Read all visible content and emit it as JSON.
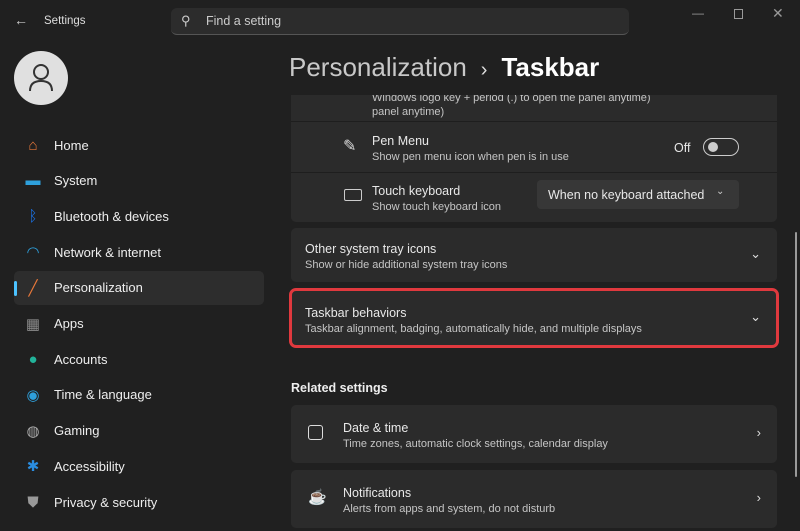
{
  "titlebar": {
    "title": "Settings",
    "search_placeholder": "Find a setting"
  },
  "breadcrumb": {
    "parent": "Personalization",
    "separator": "›",
    "current": "Taskbar"
  },
  "sidebar": {
    "items": [
      {
        "label": "Home",
        "icon": "home-icon",
        "color": "#e8783a"
      },
      {
        "label": "System",
        "icon": "monitor-icon",
        "color": "#2ea0dc"
      },
      {
        "label": "Bluetooth & devices",
        "icon": "bluetooth-icon",
        "color": "#1a73e8"
      },
      {
        "label": "Network & internet",
        "icon": "wifi-icon",
        "color": "#2ea0dc"
      },
      {
        "label": "Personalization",
        "icon": "brush-icon",
        "color": "#e8783a",
        "selected": true
      },
      {
        "label": "Apps",
        "icon": "apps-icon",
        "color": "#8a8a8a"
      },
      {
        "label": "Accounts",
        "icon": "person-icon",
        "color": "#22b39a"
      },
      {
        "label": "Time & language",
        "icon": "globe-clock-icon",
        "color": "#2ea0dc"
      },
      {
        "label": "Gaming",
        "icon": "gamepad-icon",
        "color": "#aaaaaa"
      },
      {
        "label": "Accessibility",
        "icon": "accessibility-icon",
        "color": "#2a8de0"
      },
      {
        "label": "Privacy & security",
        "icon": "shield-icon",
        "color": "#999999"
      }
    ]
  },
  "content": {
    "clipped_text": "Windows logo key + period (.) to open the panel anytime)",
    "clipped_text_line2": "panel anytime)",
    "pen_menu": {
      "title": "Pen Menu",
      "desc": "Show pen menu icon when pen is in use",
      "state": "Off"
    },
    "touch_keyboard": {
      "title": "Touch keyboard",
      "desc": "Show touch keyboard icon",
      "value": "When no keyboard attached"
    },
    "other_tray": {
      "title": "Other system tray icons",
      "desc": "Show or hide additional system tray icons"
    },
    "behaviors": {
      "title": "Taskbar behaviors",
      "desc": "Taskbar alignment, badging, automatically hide, and multiple displays"
    },
    "related_heading": "Related settings",
    "date_time": {
      "title": "Date & time",
      "desc": "Time zones, automatic clock settings, calendar display"
    },
    "notifications": {
      "title": "Notifications",
      "desc": "Alerts from apps and system, do not disturb"
    }
  },
  "colors": {
    "highlight": "#e0393e",
    "accent": "#4cc2ff"
  }
}
